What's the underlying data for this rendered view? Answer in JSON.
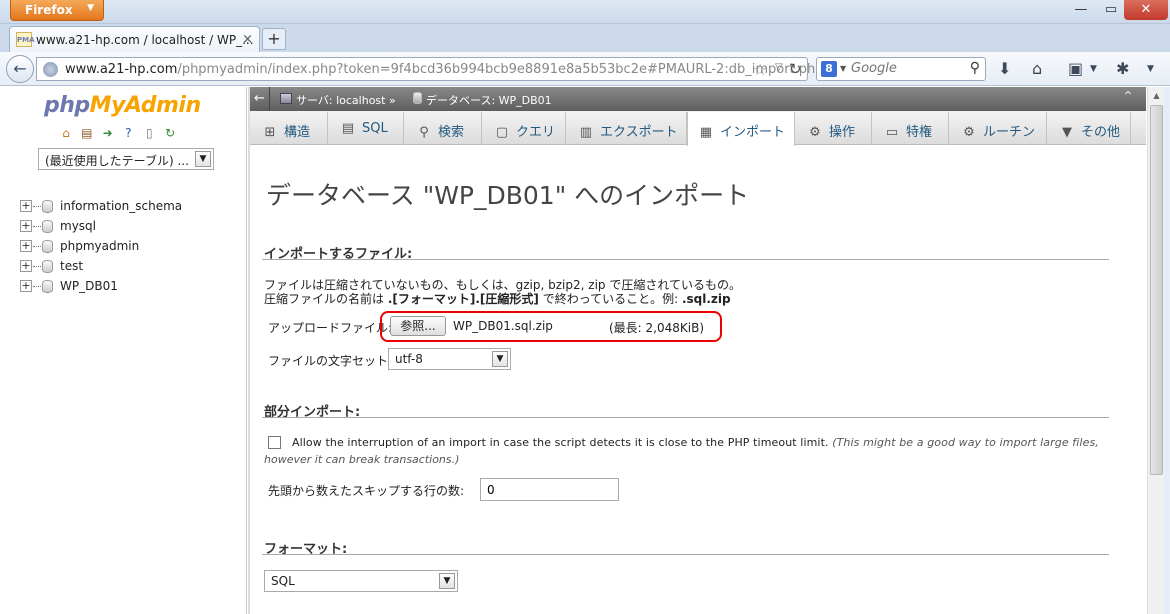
{
  "browser": {
    "app_button": "Firefox",
    "tab_title": "www.a21-hp.com / localhost / WP_...",
    "tab_favicon_text": "PMA",
    "url_host": "www.a21-hp.com",
    "url_rest": "/phpmyadmin/index.php?token=9f4bcd36b994bcb9e8891e8a5b53bc2e#PMAURL-2:db_import.ph",
    "search_placeholder": "Google",
    "search_engine_icon": "8"
  },
  "sidebar": {
    "logo_php": "php",
    "logo_my": "My",
    "logo_admin": "Admin",
    "recent_tables": "(最近使用したテーブル) ...",
    "databases": [
      "information_schema",
      "mysql",
      "phpmyadmin",
      "test",
      "WP_DB01"
    ]
  },
  "breadcrumb": {
    "server": "サーバ: localhost",
    "sep": "»",
    "database": "データベース: WP_DB01"
  },
  "tabs": [
    {
      "label": "構造",
      "icon": "structure-icon"
    },
    {
      "label": "SQL",
      "icon": "sql-icon"
    },
    {
      "label": "検索",
      "icon": "search-icon"
    },
    {
      "label": "クエリ",
      "icon": "query-icon"
    },
    {
      "label": "エクスポート",
      "icon": "export-icon"
    },
    {
      "label": "インポート",
      "icon": "import-icon"
    },
    {
      "label": "操作",
      "icon": "wrench-icon"
    },
    {
      "label": "特権",
      "icon": "privileges-icon"
    },
    {
      "label": "ルーチン",
      "icon": "routines-icon"
    },
    {
      "label": "その他",
      "icon": "more-icon"
    }
  ],
  "main": {
    "title": "データベース \"WP_DB01\" へのインポート",
    "file_section": {
      "legend": "インポートするファイル:",
      "desc1": "ファイルは圧縮されていないもの、もしくは、gzip, bzip2, zip で圧縮されているもの。",
      "desc2_a": "圧縮ファイルの名前は ",
      "desc2_b": ".[フォーマット].[圧縮形式]",
      "desc2_c": " で終わっていること。例: ",
      "desc2_d": ".sql.zip",
      "upload_label": "アップロードファイル:",
      "browse_label": "参照...",
      "file_name": "WP_DB01.sql.zip",
      "max_size": "(最長: 2,048KiB)",
      "charset_label": "ファイルの文字セット:",
      "charset_value": "utf-8"
    },
    "partial_section": {
      "legend": "部分インポート:",
      "interrupt_label": "Allow the interruption of an import in case the script detects it is close to the PHP timeout limit.",
      "interrupt_note_1": "(This might be a good way to import large files,",
      "interrupt_note_2": "however it can break transactions.)",
      "interrupt_checked": false,
      "skip_label": "先頭から数えたスキップする行の数:",
      "skip_value": "0"
    },
    "format_section": {
      "legend": "フォーマット:",
      "format_value": "SQL"
    }
  },
  "colors": {
    "highlight_ring": "#e00000",
    "tab_text": "#235a81",
    "logo_php": "#6c78af",
    "logo_myadmin": "#f8a400"
  }
}
